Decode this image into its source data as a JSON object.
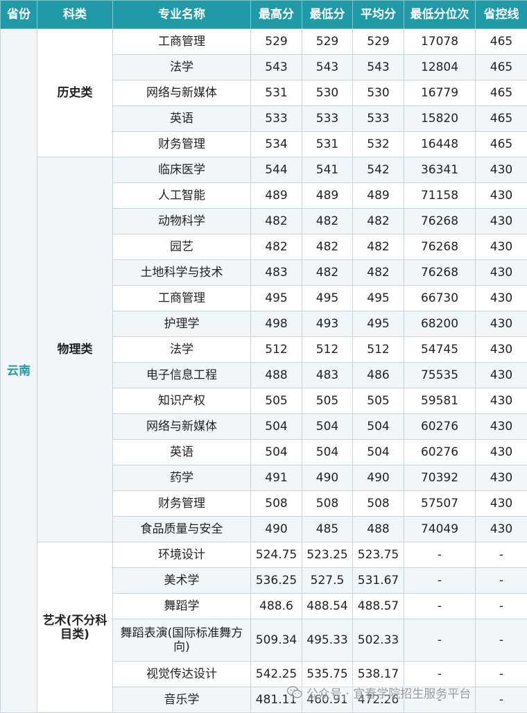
{
  "headers": [
    "省份",
    "科类",
    "专业名称",
    "最高分",
    "最低分",
    "平均分",
    "最低分位次",
    "省控线"
  ],
  "province": "云南",
  "groups": [
    {
      "category": "历史类",
      "rows": [
        [
          "工商管理",
          "529",
          "529",
          "529",
          "17078",
          "465"
        ],
        [
          "法学",
          "543",
          "543",
          "543",
          "12804",
          "465"
        ],
        [
          "网络与新媒体",
          "531",
          "530",
          "530",
          "16779",
          "465"
        ],
        [
          "英语",
          "533",
          "533",
          "533",
          "15820",
          "465"
        ],
        [
          "财务管理",
          "534",
          "531",
          "532",
          "16448",
          "465"
        ]
      ]
    },
    {
      "category": "物理类",
      "rows": [
        [
          "临床医学",
          "544",
          "541",
          "542",
          "36341",
          "430"
        ],
        [
          "人工智能",
          "489",
          "489",
          "489",
          "71158",
          "430"
        ],
        [
          "动物科学",
          "482",
          "482",
          "482",
          "76268",
          "430"
        ],
        [
          "园艺",
          "482",
          "482",
          "482",
          "76268",
          "430"
        ],
        [
          "土地科学与技术",
          "483",
          "482",
          "482",
          "76268",
          "430"
        ],
        [
          "工商管理",
          "495",
          "495",
          "495",
          "66730",
          "430"
        ],
        [
          "护理学",
          "498",
          "493",
          "495",
          "68200",
          "430"
        ],
        [
          "法学",
          "512",
          "512",
          "512",
          "54745",
          "430"
        ],
        [
          "电子信息工程",
          "488",
          "483",
          "486",
          "75535",
          "430"
        ],
        [
          "知识产权",
          "505",
          "505",
          "505",
          "59581",
          "430"
        ],
        [
          "网络与新媒体",
          "504",
          "504",
          "504",
          "60276",
          "430"
        ],
        [
          "英语",
          "504",
          "504",
          "504",
          "60276",
          "430"
        ],
        [
          "药学",
          "491",
          "490",
          "490",
          "70392",
          "430"
        ],
        [
          "财务管理",
          "508",
          "508",
          "508",
          "57507",
          "430"
        ],
        [
          "食品质量与安全",
          "490",
          "485",
          "488",
          "74049",
          "430"
        ]
      ]
    },
    {
      "category": "艺术(不分科目类)",
      "rows": [
        [
          "环境设计",
          "524.75",
          "523.25",
          "523.75",
          "-",
          "-"
        ],
        [
          "美术学",
          "536.25",
          "527.5",
          "531.67",
          "-",
          "-"
        ],
        [
          "舞蹈学",
          "488.6",
          "488.54",
          "488.57",
          "-",
          "-"
        ],
        [
          "舞蹈表演(国际标准舞方向)",
          "509.34",
          "495.33",
          "502.33",
          "-",
          "-"
        ],
        [
          "视觉传达设计",
          "542.25",
          "535.75",
          "538.17",
          "-",
          "-"
        ],
        [
          "音乐学",
          "481.11",
          "460.91",
          "472.26",
          "-",
          "-"
        ]
      ]
    }
  ],
  "watermark": "公众号 · 宜春学院招生服务平台",
  "icons": {
    "watermark": "wechat-icon"
  },
  "colors": {
    "header_bg": "#1f9aa6",
    "province_text": "#1f9aa6",
    "stripe": "#f2f6f9",
    "border": "#c9d3da"
  }
}
